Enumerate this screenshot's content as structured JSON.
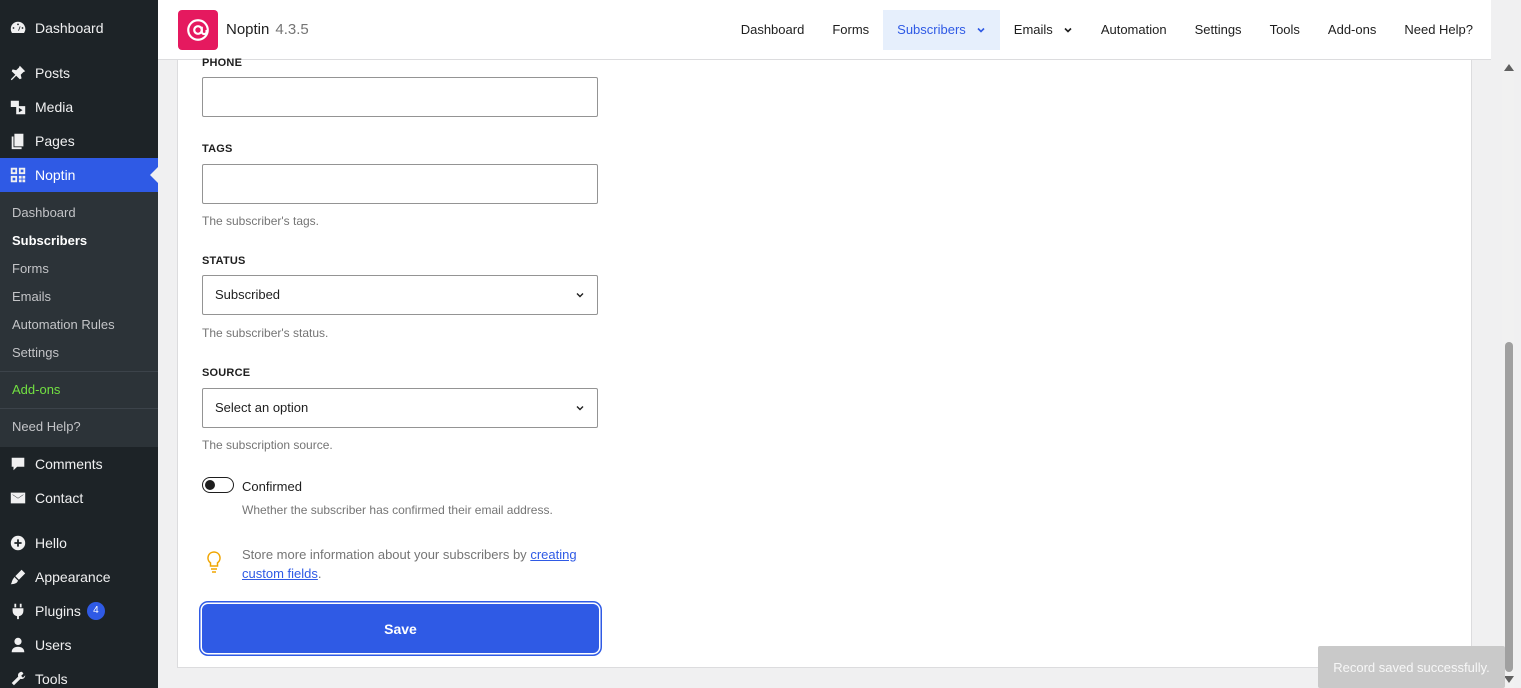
{
  "sidebar": {
    "top_items": [
      {
        "label": "Dashboard",
        "icon": "dashboard-icon"
      },
      {
        "label": "Posts",
        "icon": "pin-icon"
      },
      {
        "label": "Media",
        "icon": "media-icon"
      },
      {
        "label": "Pages",
        "icon": "pages-icon"
      },
      {
        "label": "Noptin",
        "icon": "grid-icon"
      }
    ],
    "submenu": [
      "Dashboard",
      "Subscribers",
      "Forms",
      "Emails",
      "Automation Rules",
      "Settings",
      "Add-ons",
      "Need Help?"
    ],
    "bottom_items": [
      {
        "label": "Comments",
        "icon": "comment-icon"
      },
      {
        "label": "Contact",
        "icon": "mail-icon"
      },
      {
        "label": "Hello",
        "icon": "plus-circle-icon"
      },
      {
        "label": "Appearance",
        "icon": "brush-icon"
      },
      {
        "label": "Plugins",
        "icon": "plugin-icon",
        "badge": "4"
      },
      {
        "label": "Users",
        "icon": "user-icon"
      },
      {
        "label": "Tools",
        "icon": "wrench-icon"
      }
    ]
  },
  "topbar": {
    "brand": "Noptin",
    "version": "4.3.5",
    "nav": [
      "Dashboard",
      "Forms",
      "Subscribers",
      "Emails",
      "Automation",
      "Settings",
      "Tools",
      "Add-ons",
      "Need Help?"
    ]
  },
  "form": {
    "phone_label": "PHONE",
    "phone_value": "",
    "tags_label": "TAGS",
    "tags_value": "",
    "tags_help": "The subscriber's tags.",
    "status_label": "STATUS",
    "status_value": "Subscribed",
    "status_help": "The subscriber's status.",
    "source_label": "SOURCE",
    "source_value": "Select an option",
    "source_help": "The subscription source.",
    "confirmed_label": "Confirmed",
    "confirmed_help": "Whether the subscriber has confirmed their email address.",
    "tip_text": "Store more information about your subscribers by ",
    "tip_link": "creating custom fields",
    "tip_end": ".",
    "save_label": "Save"
  },
  "toast": "Record saved successfully.",
  "colors": {
    "accent": "#2f5ae5",
    "brand": "#e5195f",
    "sidebar": "#1d2327",
    "addons_green": "#72e042"
  }
}
